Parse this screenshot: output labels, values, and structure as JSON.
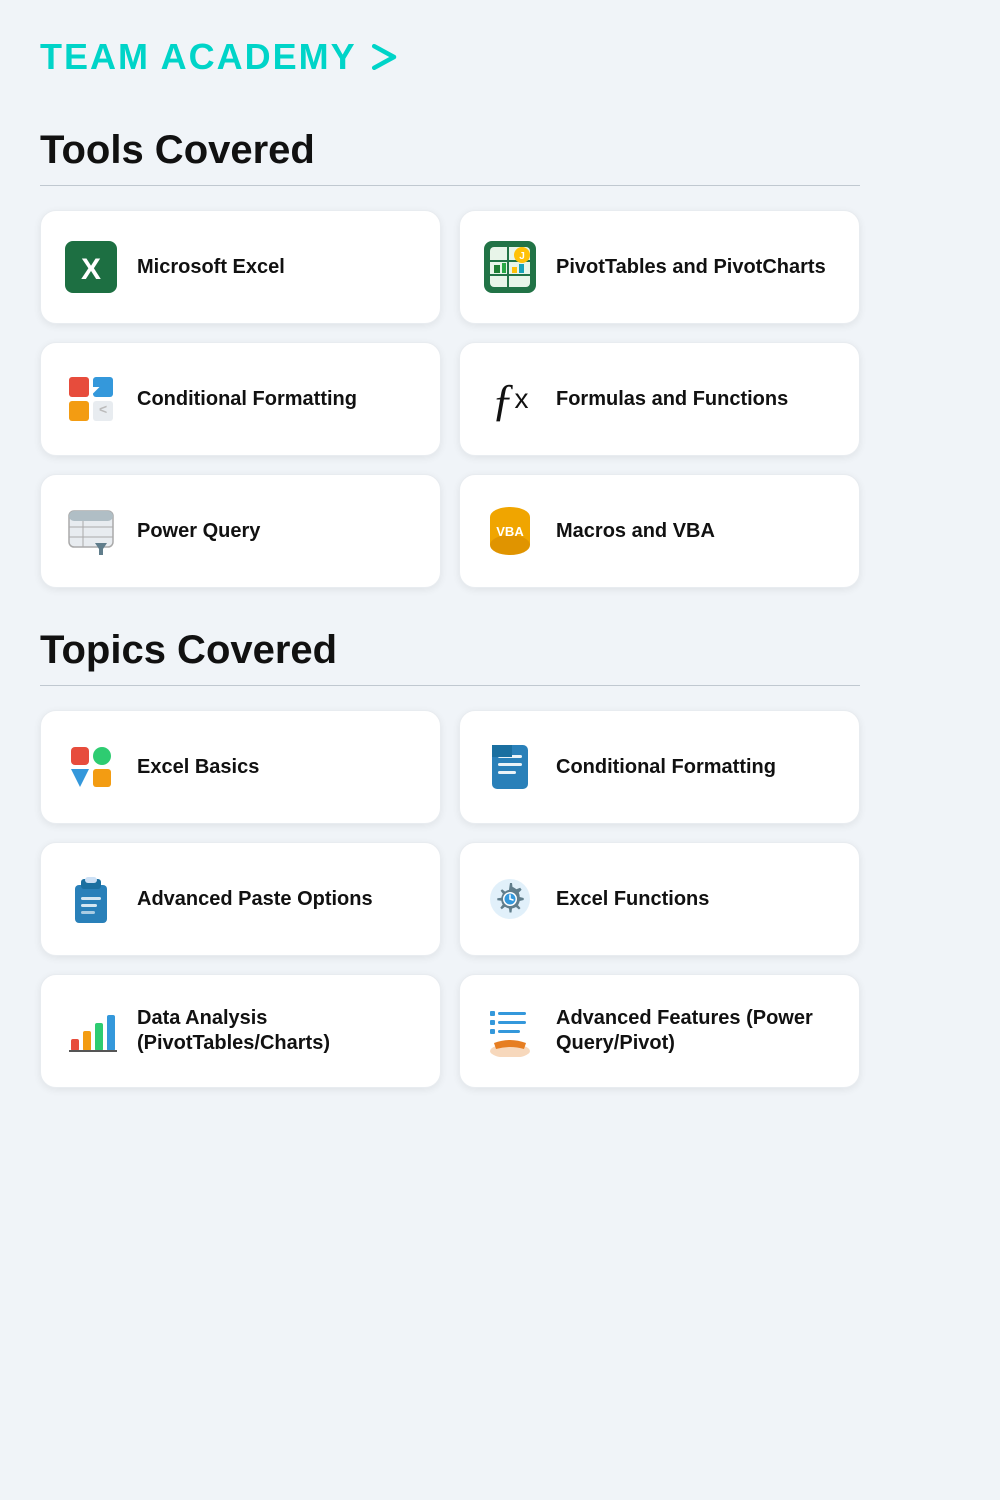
{
  "header": {
    "brand": "TEAM ACADEMY",
    "chevron": "›"
  },
  "tools_section": {
    "title": "Tools Covered",
    "cards": [
      {
        "id": "microsoft-excel",
        "label": "Microsoft Excel",
        "icon_type": "excel"
      },
      {
        "id": "pivottables",
        "label": "PivotTables and PivotCharts",
        "icon_type": "pivot"
      },
      {
        "id": "conditional-formatting",
        "label": "Conditional Formatting",
        "icon_type": "conditional"
      },
      {
        "id": "formulas-functions",
        "label": "Formulas and Functions",
        "icon_type": "fx"
      },
      {
        "id": "power-query",
        "label": "Power Query",
        "icon_type": "powerquery"
      },
      {
        "id": "macros-vba",
        "label": "Macros and VBA",
        "icon_type": "vba"
      }
    ]
  },
  "topics_section": {
    "title": "Topics Covered",
    "cards": [
      {
        "id": "excel-basics",
        "label": "Excel Basics",
        "icon_type": "basics"
      },
      {
        "id": "conditional-formatting-topic",
        "label": "Conditional Formatting",
        "icon_type": "cond-topic"
      },
      {
        "id": "advanced-paste",
        "label": "Advanced Paste Options",
        "icon_type": "paste"
      },
      {
        "id": "excel-functions",
        "label": "Excel Functions",
        "icon_type": "functions"
      },
      {
        "id": "data-analysis",
        "label": "Data Analysis (PivotTables/Charts)",
        "icon_type": "data-analysis"
      },
      {
        "id": "advanced-features",
        "label": "Advanced Features (Power Query/Pivot)",
        "icon_type": "advanced"
      }
    ]
  }
}
